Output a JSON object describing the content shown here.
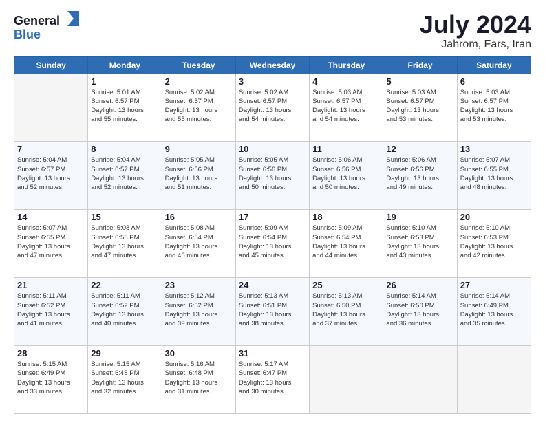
{
  "header": {
    "logo_general": "General",
    "logo_blue": "Blue",
    "title": "July 2024",
    "subtitle": "Jahrom, Fars, Iran"
  },
  "days_of_week": [
    "Sunday",
    "Monday",
    "Tuesday",
    "Wednesday",
    "Thursday",
    "Friday",
    "Saturday"
  ],
  "weeks": [
    [
      {
        "day": "",
        "info": ""
      },
      {
        "day": "1",
        "info": "Sunrise: 5:01 AM\nSunset: 6:57 PM\nDaylight: 13 hours\nand 55 minutes."
      },
      {
        "day": "2",
        "info": "Sunrise: 5:02 AM\nSunset: 6:57 PM\nDaylight: 13 hours\nand 55 minutes."
      },
      {
        "day": "3",
        "info": "Sunrise: 5:02 AM\nSunset: 6:57 PM\nDaylight: 13 hours\nand 54 minutes."
      },
      {
        "day": "4",
        "info": "Sunrise: 5:03 AM\nSunset: 6:57 PM\nDaylight: 13 hours\nand 54 minutes."
      },
      {
        "day": "5",
        "info": "Sunrise: 5:03 AM\nSunset: 6:57 PM\nDaylight: 13 hours\nand 53 minutes."
      },
      {
        "day": "6",
        "info": "Sunrise: 5:03 AM\nSunset: 6:57 PM\nDaylight: 13 hours\nand 53 minutes."
      }
    ],
    [
      {
        "day": "7",
        "info": "Sunrise: 5:04 AM\nSunset: 6:57 PM\nDaylight: 13 hours\nand 52 minutes."
      },
      {
        "day": "8",
        "info": "Sunrise: 5:04 AM\nSunset: 6:57 PM\nDaylight: 13 hours\nand 52 minutes."
      },
      {
        "day": "9",
        "info": "Sunrise: 5:05 AM\nSunset: 6:56 PM\nDaylight: 13 hours\nand 51 minutes."
      },
      {
        "day": "10",
        "info": "Sunrise: 5:05 AM\nSunset: 6:56 PM\nDaylight: 13 hours\nand 50 minutes."
      },
      {
        "day": "11",
        "info": "Sunrise: 5:06 AM\nSunset: 6:56 PM\nDaylight: 13 hours\nand 50 minutes."
      },
      {
        "day": "12",
        "info": "Sunrise: 5:06 AM\nSunset: 6:56 PM\nDaylight: 13 hours\nand 49 minutes."
      },
      {
        "day": "13",
        "info": "Sunrise: 5:07 AM\nSunset: 6:55 PM\nDaylight: 13 hours\nand 48 minutes."
      }
    ],
    [
      {
        "day": "14",
        "info": "Sunrise: 5:07 AM\nSunset: 6:55 PM\nDaylight: 13 hours\nand 47 minutes."
      },
      {
        "day": "15",
        "info": "Sunrise: 5:08 AM\nSunset: 6:55 PM\nDaylight: 13 hours\nand 47 minutes."
      },
      {
        "day": "16",
        "info": "Sunrise: 5:08 AM\nSunset: 6:54 PM\nDaylight: 13 hours\nand 46 minutes."
      },
      {
        "day": "17",
        "info": "Sunrise: 5:09 AM\nSunset: 6:54 PM\nDaylight: 13 hours\nand 45 minutes."
      },
      {
        "day": "18",
        "info": "Sunrise: 5:09 AM\nSunset: 6:54 PM\nDaylight: 13 hours\nand 44 minutes."
      },
      {
        "day": "19",
        "info": "Sunrise: 5:10 AM\nSunset: 6:53 PM\nDaylight: 13 hours\nand 43 minutes."
      },
      {
        "day": "20",
        "info": "Sunrise: 5:10 AM\nSunset: 6:53 PM\nDaylight: 13 hours\nand 42 minutes."
      }
    ],
    [
      {
        "day": "21",
        "info": "Sunrise: 5:11 AM\nSunset: 6:52 PM\nDaylight: 13 hours\nand 41 minutes."
      },
      {
        "day": "22",
        "info": "Sunrise: 5:11 AM\nSunset: 6:52 PM\nDaylight: 13 hours\nand 40 minutes."
      },
      {
        "day": "23",
        "info": "Sunrise: 5:12 AM\nSunset: 6:52 PM\nDaylight: 13 hours\nand 39 minutes."
      },
      {
        "day": "24",
        "info": "Sunrise: 5:13 AM\nSunset: 6:51 PM\nDaylight: 13 hours\nand 38 minutes."
      },
      {
        "day": "25",
        "info": "Sunrise: 5:13 AM\nSunset: 6:50 PM\nDaylight: 13 hours\nand 37 minutes."
      },
      {
        "day": "26",
        "info": "Sunrise: 5:14 AM\nSunset: 6:50 PM\nDaylight: 13 hours\nand 36 minutes."
      },
      {
        "day": "27",
        "info": "Sunrise: 5:14 AM\nSunset: 6:49 PM\nDaylight: 13 hours\nand 35 minutes."
      }
    ],
    [
      {
        "day": "28",
        "info": "Sunrise: 5:15 AM\nSunset: 6:49 PM\nDaylight: 13 hours\nand 33 minutes."
      },
      {
        "day": "29",
        "info": "Sunrise: 5:15 AM\nSunset: 6:48 PM\nDaylight: 13 hours\nand 32 minutes."
      },
      {
        "day": "30",
        "info": "Sunrise: 5:16 AM\nSunset: 6:48 PM\nDaylight: 13 hours\nand 31 minutes."
      },
      {
        "day": "31",
        "info": "Sunrise: 5:17 AM\nSunset: 6:47 PM\nDaylight: 13 hours\nand 30 minutes."
      },
      {
        "day": "",
        "info": ""
      },
      {
        "day": "",
        "info": ""
      },
      {
        "day": "",
        "info": ""
      }
    ]
  ]
}
